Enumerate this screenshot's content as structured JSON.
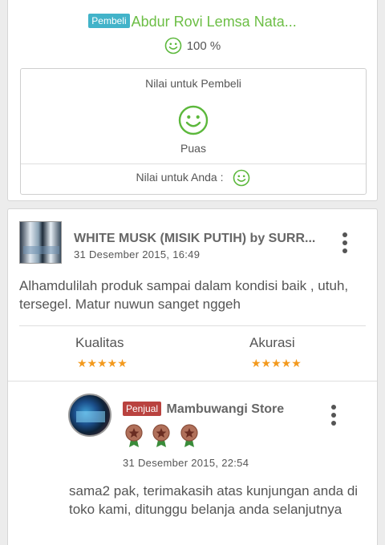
{
  "buyer_section": {
    "badge": "Pembeli",
    "name": "Abdur Rovi Lemsa Nata...",
    "percentage": "100 %",
    "rating_title": "Nilai untuk Pembeli",
    "rating_status": "Puas",
    "your_rating_label": "Nilai untuk Anda :",
    "icons": [
      "smiley-icon"
    ]
  },
  "review": {
    "product_title": "WHITE MUSK (MISIK PUTIH) by SURR...",
    "date": "31 Desember 2015, 16:49",
    "text": "Alhamdulilah produk sampai dalam kondisi baik , utuh, tersegel. Matur nuwun sanget nggeh",
    "quality_label": "Kualitas",
    "quality_stars": "★★★★★",
    "quality_rating": 5,
    "accuracy_label": "Akurasi",
    "accuracy_stars": "★★★★★",
    "accuracy_rating": 5
  },
  "reply": {
    "badge": "Penjual",
    "seller_name": "Mambuwangi Store",
    "medal_count": 3,
    "date": "31 Desember 2015, 22:54",
    "text": "sama2 pak, terimakasih atas kunjungan anda di toko kami, ditunggu belanja anda selanjutnya"
  },
  "colors": {
    "buyer_badge": "#42b3c9",
    "seller_badge": "#b9423f",
    "buyer_name": "#6cbe45",
    "smiley": "#5cb83c",
    "stars": "#f39a1e"
  }
}
